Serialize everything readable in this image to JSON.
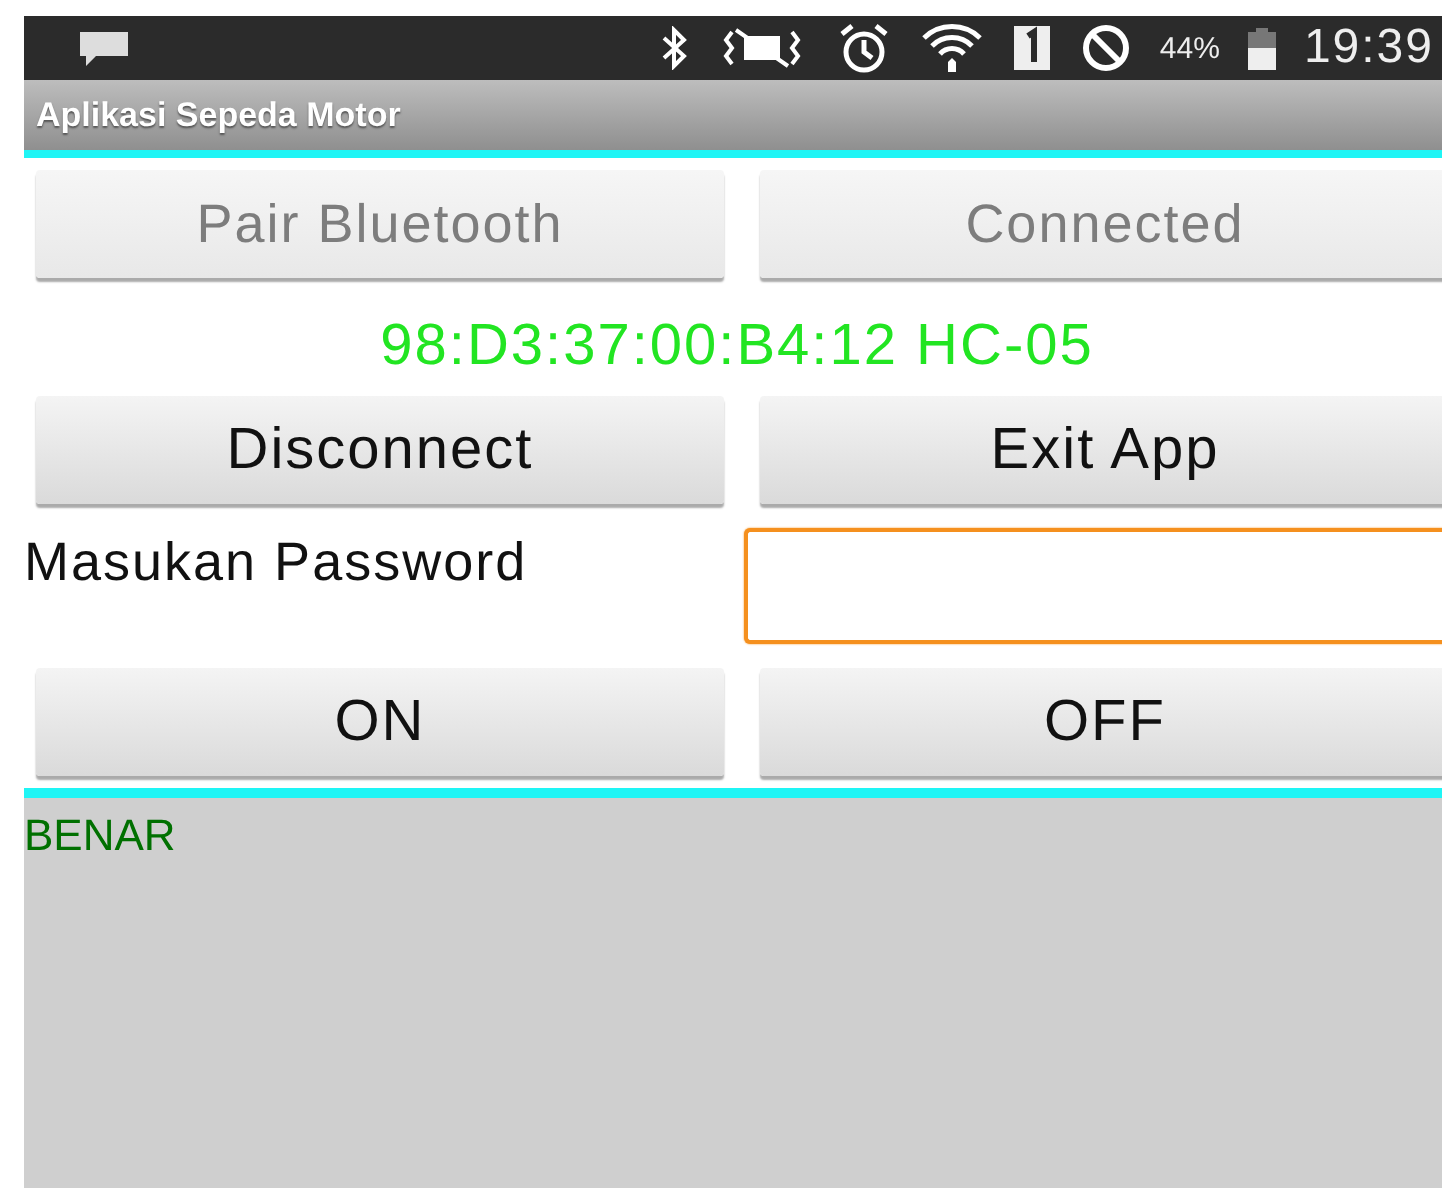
{
  "status_bar": {
    "battery": "44%",
    "time": "19:39"
  },
  "app_bar": {
    "title": "Aplikasi Sepeda Motor"
  },
  "top_buttons": [
    {
      "label": "Pair Bluetooth",
      "disabled": true
    },
    {
      "label": "Connected",
      "disabled": true
    }
  ],
  "device_label": "98:D3:37:00:B4:12 HC-05",
  "action_buttons": [
    {
      "label": "Disconnect",
      "disabled": false
    },
    {
      "label": "Exit App",
      "disabled": false
    }
  ],
  "password": {
    "label": "Masukan Password",
    "focused": true
  },
  "switch_buttons": [
    {
      "label": "ON",
      "disabled": false
    },
    {
      "label": "OFF",
      "disabled": false
    }
  ],
  "output": {
    "text": "BENAR"
  }
}
